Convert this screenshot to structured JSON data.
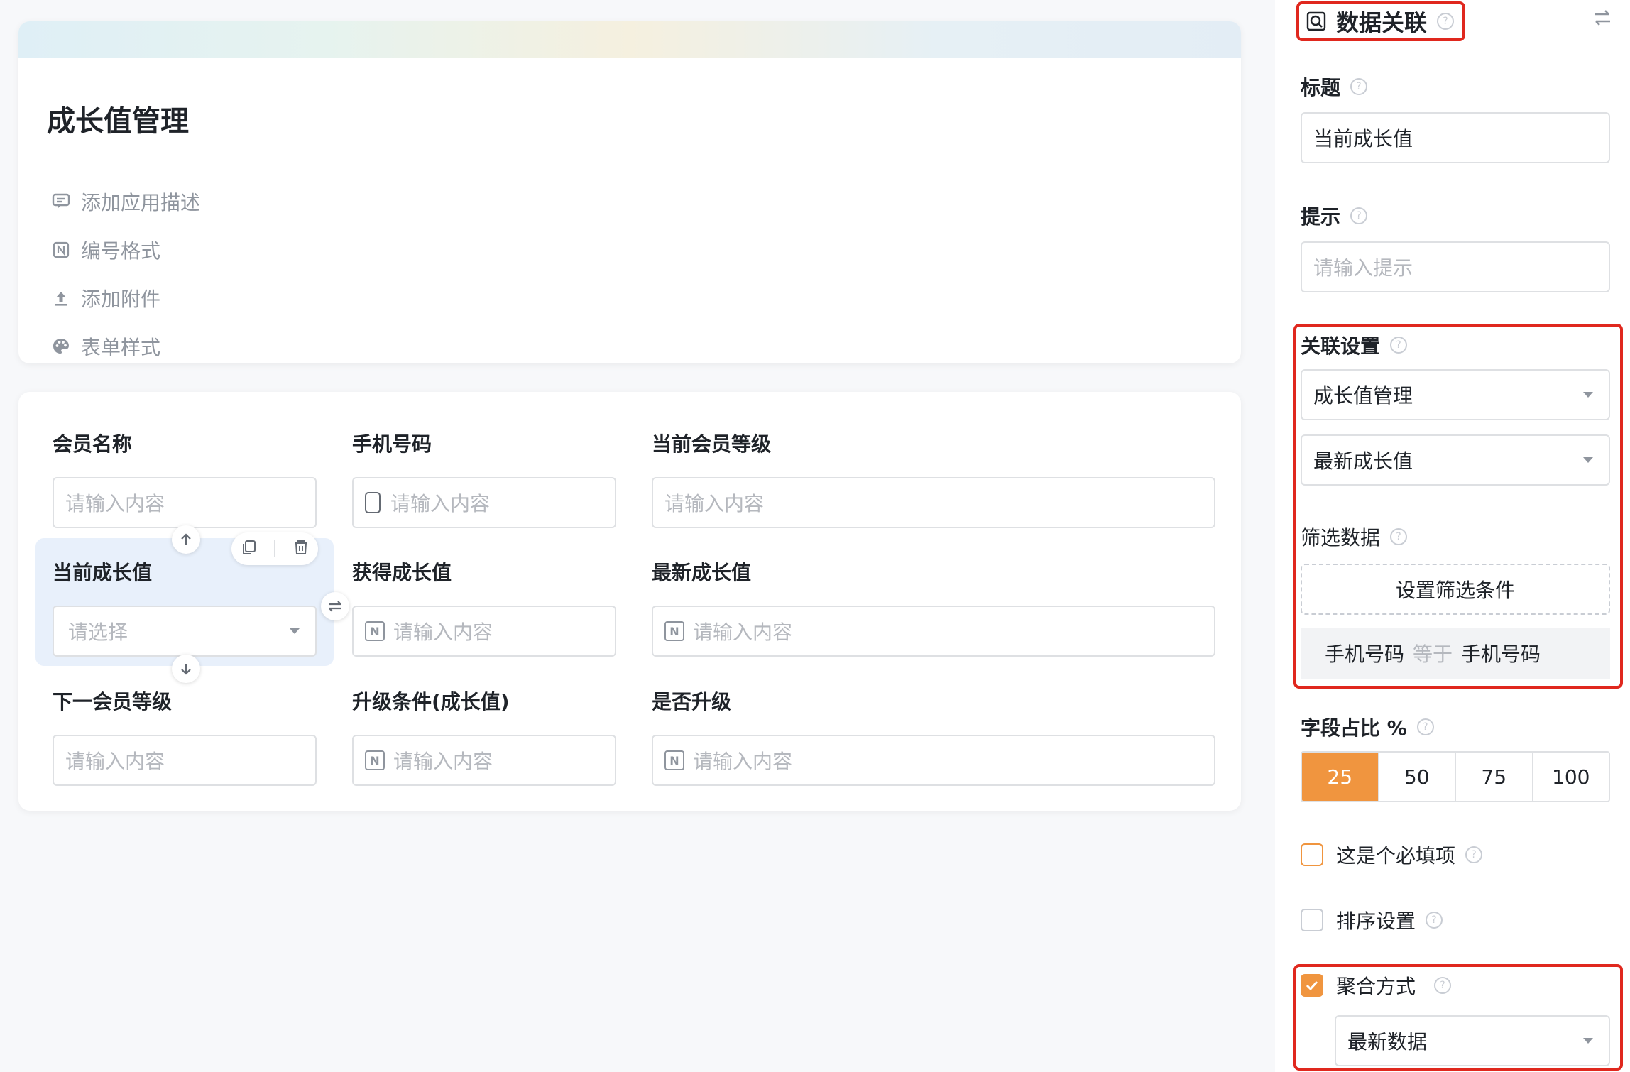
{
  "app": {
    "title": "成长值管理",
    "meta": [
      {
        "icon": "comment-icon",
        "label": "添加应用描述"
      },
      {
        "icon": "number-format-icon",
        "label": "编号格式"
      },
      {
        "icon": "upload-icon",
        "label": "添加附件"
      },
      {
        "icon": "palette-icon",
        "label": "表单样式"
      }
    ]
  },
  "form": {
    "fields": [
      {
        "label": "会员名称",
        "placeholder": "请输入内容"
      },
      {
        "label": "手机号码",
        "placeholder": "请输入内容"
      },
      {
        "label": "当前会员等级",
        "placeholder": "请输入内容"
      },
      {
        "label": "当前成长值",
        "placeholder": "请选择"
      },
      {
        "label": "获得成长值",
        "placeholder": "请输入内容"
      },
      {
        "label": "最新成长值",
        "placeholder": "请输入内容"
      },
      {
        "label": "下一会员等级",
        "placeholder": "请输入内容"
      },
      {
        "label": "升级条件(成长值)",
        "placeholder": "请输入内容"
      },
      {
        "label": "是否升级",
        "placeholder": "请输入内容"
      }
    ]
  },
  "sidebar": {
    "header": "数据关联",
    "title_label": "标题",
    "title_value": "当前成长值",
    "hint_label": "提示",
    "hint_placeholder": "请输入提示",
    "relation_label": "关联设置",
    "relation_form": "成长值管理",
    "relation_field": "最新成长值",
    "filter_label": "筛选数据",
    "filter_button": "设置筛选条件",
    "condition": {
      "field": "手机号码",
      "op": "等于",
      "value": "手机号码"
    },
    "width_label": "字段占比 %",
    "width_options": [
      "25",
      "50",
      "75",
      "100"
    ],
    "width_selected": "25",
    "required_label": "这是个必填项",
    "sort_label": "排序设置",
    "aggregate_label": "聚合方式",
    "aggregate_value": "最新数据"
  },
  "colors": {
    "accent": "#f0953f",
    "highlight": "#e0281e",
    "selected_bg": "#e8f0fb"
  }
}
